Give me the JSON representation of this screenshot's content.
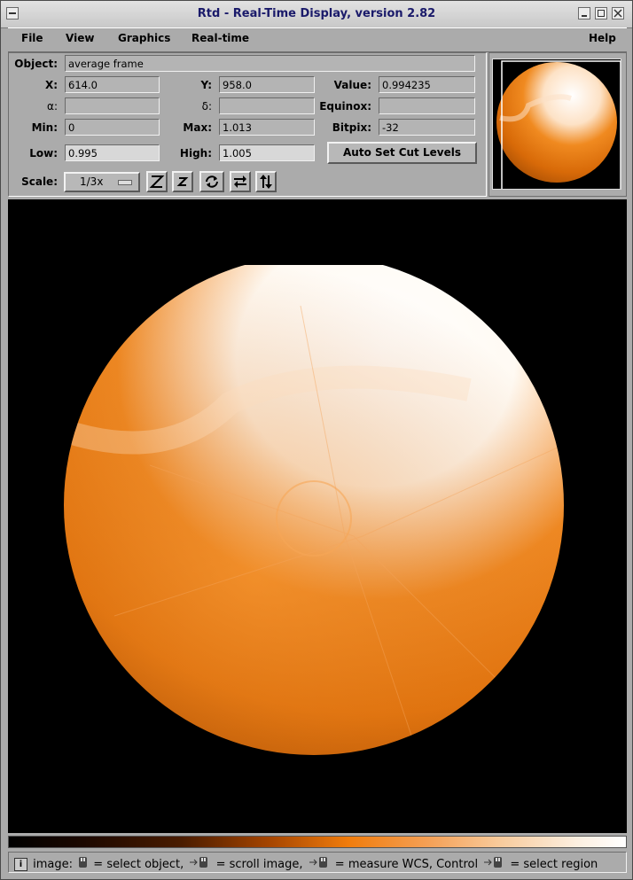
{
  "window": {
    "title": "Rtd - Real-Time Display, version 2.82"
  },
  "menubar": {
    "file": "File",
    "view": "View",
    "graphics": "Graphics",
    "realtime": "Real-time",
    "help": "Help"
  },
  "info": {
    "object_label": "Object:",
    "object_value": "average frame",
    "x_label": "X:",
    "x_value": "614.0",
    "y_label": "Y:",
    "y_value": "958.0",
    "value_label": "Value:",
    "value_value": "0.994235",
    "alpha_label": "α:",
    "alpha_value": "",
    "delta_label": "δ:",
    "delta_value": "",
    "equinox_label": "Equinox:",
    "equinox_value": "",
    "min_label": "Min:",
    "min_value": "0",
    "max_label": "Max:",
    "max_value": "1.013",
    "bitpix_label": "Bitpix:",
    "bitpix_value": "-32",
    "low_label": "Low:",
    "low_value": "0.995",
    "high_label": "High:",
    "high_value": "1.005",
    "auto_cut_label": "Auto Set Cut Levels",
    "scale_label": "Scale:",
    "scale_value": "1/3x"
  },
  "colors": {
    "accent": "#f07c0c",
    "background": "#ababab",
    "image_bg": "#000000"
  },
  "status": {
    "icon": "info-icon",
    "text1": "image:",
    "text2": "= select object,",
    "text3": "= scroll image,",
    "text4": "= measure WCS, Control",
    "text5": "= select region"
  }
}
